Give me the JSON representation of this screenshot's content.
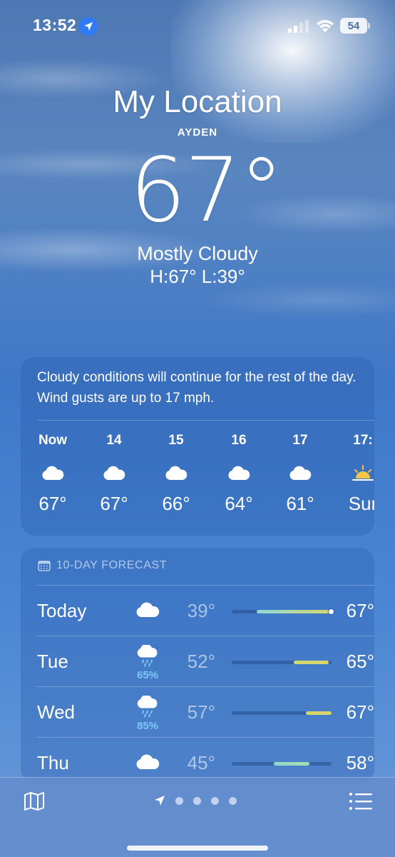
{
  "status_bar": {
    "time": "13:52",
    "battery": "54",
    "icons": [
      "location-arrow-icon",
      "cellular-signal-icon",
      "wifi-icon",
      "battery-icon"
    ]
  },
  "header": {
    "title": "My Location",
    "subtitle": "AYDEN",
    "temperature": "67°",
    "condition": "Mostly Cloudy",
    "hilo": "H:67°  L:39°"
  },
  "hourly": {
    "summary": "Cloudy conditions will continue for the rest of the day. Wind gusts are up to 17 mph.",
    "hours": [
      {
        "label": "Now",
        "icon": "cloud-icon",
        "temp": "67°"
      },
      {
        "label": "14",
        "icon": "cloud-icon",
        "temp": "67°"
      },
      {
        "label": "15",
        "icon": "cloud-icon",
        "temp": "66°"
      },
      {
        "label": "16",
        "icon": "cloud-icon",
        "temp": "64°"
      },
      {
        "label": "17",
        "icon": "cloud-icon",
        "temp": "61°"
      },
      {
        "label": "17:",
        "icon": "sunset-icon",
        "temp": "Sur"
      }
    ]
  },
  "daily": {
    "header": "10-DAY FORECAST",
    "header_icon": "calendar-icon",
    "days": [
      {
        "name": "Today",
        "icon": "cloud-icon",
        "pop": "",
        "low": "39°",
        "high": "67°",
        "range_start": 0.25,
        "range_end": 1.0,
        "current": 1.0,
        "color_start": "#8fd9d8",
        "color_end": "#d8d56a"
      },
      {
        "name": "Tue",
        "icon": "cloud-rain-icon",
        "pop": "65%",
        "low": "52°",
        "high": "65°",
        "range_start": 0.62,
        "range_end": 0.97,
        "current": null,
        "color_start": "#cfd870",
        "color_end": "#d8d56a"
      },
      {
        "name": "Wed",
        "icon": "cloud-rain-icon",
        "pop": "85%",
        "low": "57°",
        "high": "67°",
        "range_start": 0.74,
        "range_end": 1.0,
        "current": null,
        "color_start": "#d8d56a",
        "color_end": "#dcd26a"
      },
      {
        "name": "Thu",
        "icon": "cloud-icon",
        "pop": "",
        "low": "45°",
        "high": "58°",
        "range_start": 0.42,
        "range_end": 0.78,
        "current": null,
        "color_start": "#8fd9c8",
        "color_end": "#a8dcb0"
      }
    ]
  },
  "toolbar": {
    "map_icon": "map-icon",
    "list_icon": "list-icon",
    "page_count": 5,
    "current_page": "location-arrow-icon"
  }
}
